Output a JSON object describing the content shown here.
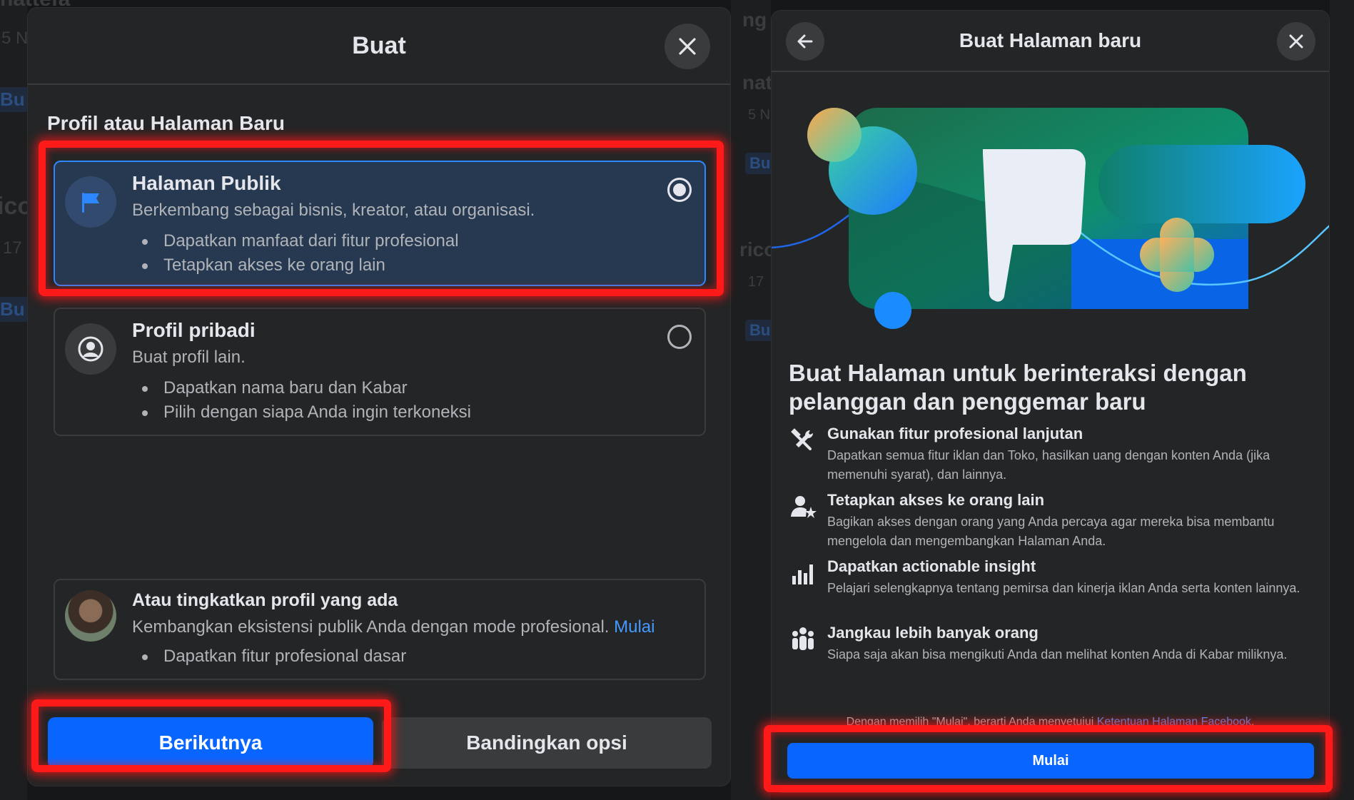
{
  "background": {
    "fragments": [
      "nattefa",
      "5 N",
      "Bu",
      "ico",
      "17",
      "Bu",
      "ng",
      "nat",
      "5 N",
      "Bu",
      "rico",
      "17",
      "Bu"
    ]
  },
  "create_dialog": {
    "title": "Buat",
    "section_label": "Profil atau Halaman Baru",
    "options": [
      {
        "title": "Halaman Publik",
        "subtitle": "Berkembang sebagai bisnis, kreator, atau organisasi.",
        "bullets": [
          "Dapatkan manfaat dari fitur profesional",
          "Tetapkan akses ke orang lain"
        ],
        "icon": "flag-icon",
        "selected": true
      },
      {
        "title": "Profil pribadi",
        "subtitle": "Buat profil lain.",
        "bullets": [
          "Dapatkan nama baru dan Kabar",
          "Pilih dengan siapa Anda ingin terkoneksi"
        ],
        "icon": "person-circle-icon",
        "selected": false
      }
    ],
    "upgrade": {
      "title": "Atau tingkatkan profil yang ada",
      "text": "Kembangkan eksistensi publik Anda dengan mode profesional.",
      "link": "Mulai",
      "bullets": [
        "Dapatkan fitur profesional dasar"
      ]
    },
    "next_button": "Berikutnya",
    "compare_button": "Bandingkan opsi"
  },
  "page_dialog": {
    "title": "Buat Halaman baru",
    "heading": "Buat Halaman untuk berinteraksi dengan pelanggan dan penggemar baru",
    "features": [
      {
        "icon": "tools-icon",
        "title": "Gunakan fitur profesional lanjutan",
        "desc": "Dapatkan semua fitur iklan dan Toko, hasilkan uang dengan konten Anda (jika memenuhi syarat), dan lainnya."
      },
      {
        "icon": "person-star-icon",
        "title": "Tetapkan akses ke orang lain",
        "desc": "Bagikan akses dengan orang yang Anda percaya agar mereka bisa membantu mengelola dan mengembangkan Halaman Anda."
      },
      {
        "icon": "bar-chart-icon",
        "title": "Dapatkan actionable insight",
        "desc": "Pelajari selengkapnya tentang pemirsa dan kinerja iklan Anda serta konten lainnya."
      },
      {
        "icon": "group-icon",
        "title": "Jangkau lebih banyak orang",
        "desc": "Siapa saja akan bisa mengikuti Anda dan melihat konten Anda di Kabar miliknya."
      }
    ],
    "terms_text": "Dengan memilih \"Mulai\", berarti Anda menyetujui",
    "terms_link": "Ketentuan Halaman Facebook",
    "terms_end": ".",
    "start_button": "Mulai"
  },
  "colors": {
    "primary": "#0866ff",
    "highlight": "#ff1a1a",
    "panel": "#242526",
    "link": "#4599ff"
  }
}
